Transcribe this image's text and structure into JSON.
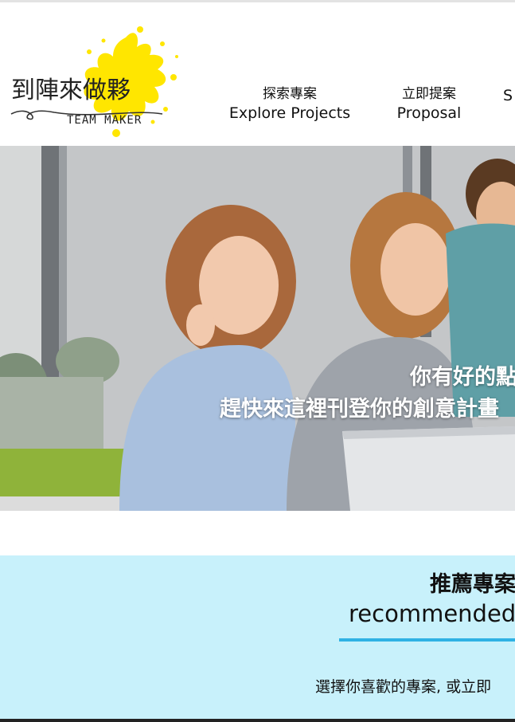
{
  "logo": {
    "name_zh": "到陣來做夥",
    "name_en": "TEAM MAKER",
    "accent_color": "#ffe600"
  },
  "nav": {
    "items": [
      {
        "zh": "探索專案",
        "en": "Explore Projects"
      },
      {
        "zh": "立即提案",
        "en": "Proposal"
      },
      {
        "zh": "",
        "en": "S"
      }
    ]
  },
  "hero": {
    "line1": "你有好的點子",
    "line2": "趕快來這裡刊登你的創意計畫"
  },
  "recommended": {
    "title_zh": "推薦專案",
    "title_en": "recommended",
    "description": "選擇你喜歡的專案, 或立即",
    "background": "#c8f1fb",
    "underline_color": "#2fb2e4"
  }
}
